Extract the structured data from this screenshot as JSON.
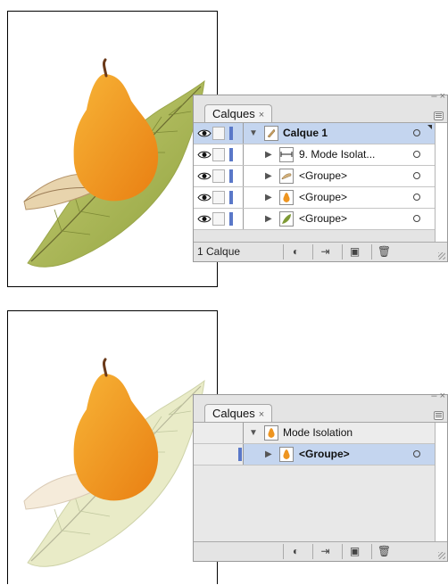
{
  "top": {
    "panel": {
      "tab_label": "Calques",
      "tab_close": "×",
      "window_controls": "– ×",
      "rows": [
        {
          "label": "Calque 1",
          "bold": true,
          "level": 0,
          "selected": true,
          "thumb": "pear-slice"
        },
        {
          "label": "9. Mode Isolat...",
          "bold": false,
          "level": 1,
          "selected": false,
          "thumb": "path"
        },
        {
          "label": "<Groupe>",
          "bold": false,
          "level": 1,
          "selected": false,
          "thumb": "pear-slice"
        },
        {
          "label": "<Groupe>",
          "bold": false,
          "level": 1,
          "selected": false,
          "thumb": "pear"
        },
        {
          "label": "<Groupe>",
          "bold": false,
          "level": 1,
          "selected": false,
          "thumb": "leaf"
        }
      ],
      "layer_count": "1 Calque"
    }
  },
  "bottom": {
    "panel": {
      "tab_label": "Calques",
      "tab_close": "×",
      "window_controls": "– ×",
      "rows": [
        {
          "label": "Mode Isolation",
          "bold": false,
          "level": 0,
          "selected": false,
          "thumb": "pear"
        },
        {
          "label": "<Groupe>",
          "bold": true,
          "level": 1,
          "selected": true,
          "thumb": "pear"
        }
      ],
      "layer_count": ""
    }
  },
  "icons": {
    "visibility": "eye-icon",
    "expand": "triangle-right-icon",
    "collapse": "triangle-down-icon",
    "target": "target-circle-icon",
    "bottom_buttons": [
      "make-clipping-mask-icon",
      "create-sublayer-icon",
      "create-layer-icon",
      "delete-icon"
    ]
  },
  "colors": {
    "selection": "#c4d5ef",
    "layer_color": "#5a78c8",
    "pear": "#f0a020",
    "leaf": "#b7c15c"
  }
}
